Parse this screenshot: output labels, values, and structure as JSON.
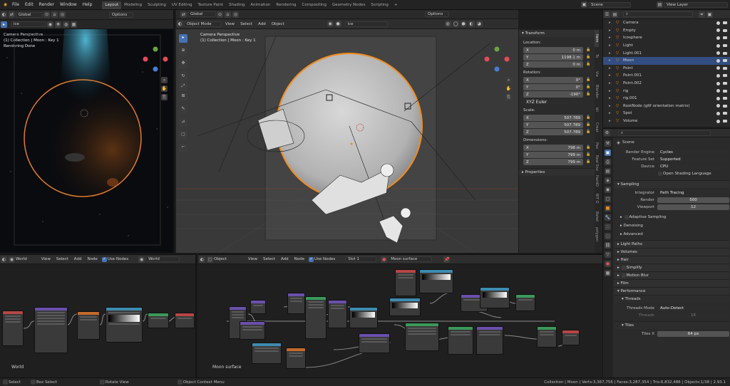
{
  "top_menu": [
    "File",
    "Edit",
    "Render",
    "Window",
    "Help"
  ],
  "workspace_tabs": [
    "Layout",
    "Modeling",
    "Sculpting",
    "UV Editing",
    "Texture Paint",
    "Shading",
    "Animation",
    "Rendering",
    "Compositing",
    "Geometry Nodes",
    "Scripting"
  ],
  "active_tab": "Layout",
  "scene_name": "Scene",
  "view_layer": "View Layer",
  "left_viewport": {
    "orientation": "Global",
    "options_label": "Options",
    "search": "ice",
    "line1": "Camera Perspective",
    "line2": "(1) Collection | Moon : Key 1",
    "line3": "Rendering Done"
  },
  "main_viewport": {
    "orientation": "Global",
    "options_label": "Options",
    "mode": "Object Mode",
    "menus": [
      "View",
      "Select",
      "Add",
      "Object"
    ],
    "search": "ice",
    "line1": "Camera Perspective",
    "line2": "(1) Collection | Moon : Key 1"
  },
  "n_panel": {
    "transform_title": "Transform",
    "location_label": "Location:",
    "location": [
      {
        "axis": "X",
        "value": "0 m"
      },
      {
        "axis": "Y",
        "value": "1198.1 m"
      },
      {
        "axis": "Z",
        "value": "0 m"
      }
    ],
    "rotation_label": "Rotation:",
    "rotation": [
      {
        "axis": "X",
        "value": "0°"
      },
      {
        "axis": "Y",
        "value": "0°"
      },
      {
        "axis": "Z",
        "value": "-190°"
      }
    ],
    "rotation_mode": "XYZ Euler",
    "scale_label": "Scale:",
    "scale": [
      {
        "axis": "X",
        "value": "507.789"
      },
      {
        "axis": "Y",
        "value": "507.789"
      },
      {
        "axis": "Z",
        "value": "507.789"
      }
    ],
    "dimensions_label": "Dimensions:",
    "dimensions": [
      {
        "axis": "X",
        "value": "798 m"
      },
      {
        "axis": "Y",
        "value": "799 m"
      },
      {
        "axis": "Z",
        "value": "799 m"
      }
    ],
    "properties_title": "Properties",
    "side_tabs": [
      "Item",
      "To",
      "Vie",
      "Blender",
      "bli",
      "Creat",
      "Pao",
      "Real Sno",
      "HardO",
      "BIT O",
      "Baket",
      "polygon"
    ]
  },
  "outliner": {
    "items": [
      {
        "name": "Camera",
        "selected": false
      },
      {
        "name": "Empty",
        "selected": false
      },
      {
        "name": "Icosphere",
        "selected": false
      },
      {
        "name": "Light",
        "selected": false
      },
      {
        "name": "Light.001",
        "selected": false
      },
      {
        "name": "Moon",
        "selected": true
      },
      {
        "name": "Point",
        "selected": false
      },
      {
        "name": "Point.001",
        "selected": false
      },
      {
        "name": "Point.002",
        "selected": false
      },
      {
        "name": "rig",
        "selected": false
      },
      {
        "name": "rig.001",
        "selected": false
      },
      {
        "name": "RootNode (gltf orientation matrix)",
        "selected": false
      },
      {
        "name": "Spot",
        "selected": false
      },
      {
        "name": "Volume",
        "selected": false
      }
    ]
  },
  "properties": {
    "scene_label": "Scene",
    "render_engine_label": "Render Engine",
    "render_engine": "Cycles",
    "feature_set_label": "Feature Set",
    "feature_set": "Supported",
    "device_label": "Device",
    "device": "CPU",
    "osl_label": "Open Shading Language",
    "sampling_label": "Sampling",
    "integrator_label": "Integrator",
    "integrator": "Path Tracing",
    "render_label": "Render",
    "render_samples": "500",
    "viewport_label": "Viewport",
    "viewport_samples": "12",
    "adaptive_label": "Adaptive Sampling",
    "denoising_label": "Denoising",
    "advanced_label": "Advanced",
    "light_paths_label": "Light Paths",
    "volumes_label": "Volumes",
    "hair_label": "Hair",
    "simplify_label": "Simplify",
    "motion_blur_label": "Motion Blur",
    "film_label": "Film",
    "performance_label": "Performance",
    "threads_label": "Threads",
    "threads_mode_label": "Threads Mode",
    "threads_mode": "Auto-Detect",
    "threads_count_label": "Threads",
    "threads_count": "16",
    "tiles_label": "Tiles",
    "tiles_x_label": "Tiles X",
    "tiles_x": "64 px"
  },
  "world_editor": {
    "world_label": "World",
    "menus": [
      "View",
      "Select",
      "Add",
      "Node"
    ],
    "use_nodes": "Use Nodes",
    "world_field": "World",
    "bottom_label": "World"
  },
  "shader_editor": {
    "object_label": "Object",
    "menus": [
      "View",
      "Select",
      "Add",
      "Node"
    ],
    "use_nodes": "Use Nodes",
    "slot": "Slot 1",
    "material": "Moon surface",
    "bottom_label": "Moon surface"
  },
  "status_bar": {
    "select": "Select",
    "box_select": "Box Select",
    "rotate_view": "Rotate View",
    "context_menu": "Object Context Menu",
    "stats": "Collection | Moon | Verts:3,367,756 | Faces:3,287,354 | Tris:6,832,486 | Objects:1/38 | 2.93.1"
  },
  "colors": {
    "accent": "#4772b3",
    "selection_orange": "#f08c1e",
    "header_bg": "#2e2e2e",
    "panel_bg": "#2b2b2b"
  }
}
